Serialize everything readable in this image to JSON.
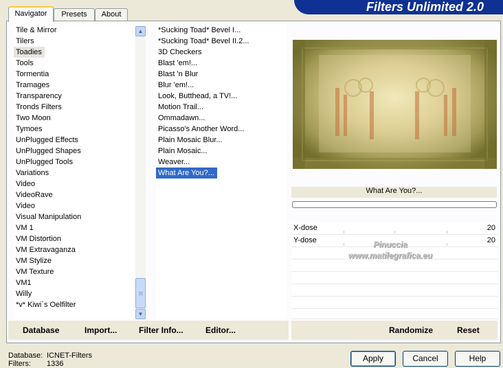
{
  "app": {
    "banner_title": "Filters Unlimited 2.0"
  },
  "tabs": [
    {
      "label": "Navigator",
      "active": true
    },
    {
      "label": "Presets",
      "active": false
    },
    {
      "label": "About",
      "active": false
    }
  ],
  "categories": {
    "items": [
      "Tile & Mirror",
      "Tilers",
      "Toadies",
      "Tools",
      "Tormentia",
      "Tramages",
      "Transparency",
      "Tronds Filters",
      "Two Moon",
      "Tymoes",
      "UnPlugged Effects",
      "UnPlugged Shapes",
      "UnPlugged Tools",
      "Variations",
      "Video",
      "VideoRave",
      "Video",
      "Visual Manipulation",
      "VM 1",
      "VM Distortion",
      "VM Extravaganza",
      "VM Stylize",
      "VM Texture",
      "VM1",
      "Willy",
      "*v* Kiwi`s Oelfilter"
    ],
    "selected": "Toadies"
  },
  "filters": {
    "items": [
      "*Sucking Toad*  Bevel I...",
      "*Sucking Toad*  Bevel II.2...",
      "3D Checkers",
      "Blast 'em!...",
      "Blast 'n Blur",
      "Blur 'em!...",
      "Look, Butthead, a TV!...",
      "Motion Trail...",
      "Ommadawn...",
      "Picasso's Another Word...",
      "Plain Mosaic Blur...",
      "Plain Mosaic...",
      "Weaver...",
      "What Are You?..."
    ],
    "selected": "What Are You?..."
  },
  "toolbar": {
    "database": "Database",
    "import": "Import...",
    "filter_info": "Filter Info...",
    "editor": "Editor..."
  },
  "preview": {
    "filter_name": "What Are You?..."
  },
  "params": [
    {
      "label": "X-dose",
      "value": "20"
    },
    {
      "label": "Y-dose",
      "value": "20"
    }
  ],
  "watermark": {
    "line1": "Pinuccia",
    "line2": "www.matilegrafica.eu"
  },
  "right_toolbar": {
    "randomize": "Randomize",
    "reset": "Reset"
  },
  "status": {
    "database_label": "Database:",
    "database_value": "ICNET-Filters",
    "filters_label": "Filters:",
    "filters_value": "1336"
  },
  "buttons": {
    "apply": "Apply",
    "cancel": "Cancel",
    "help": "Help"
  },
  "colors": {
    "banner": "#0e3193",
    "selection": "#316ac5",
    "face": "#ece9d8"
  }
}
